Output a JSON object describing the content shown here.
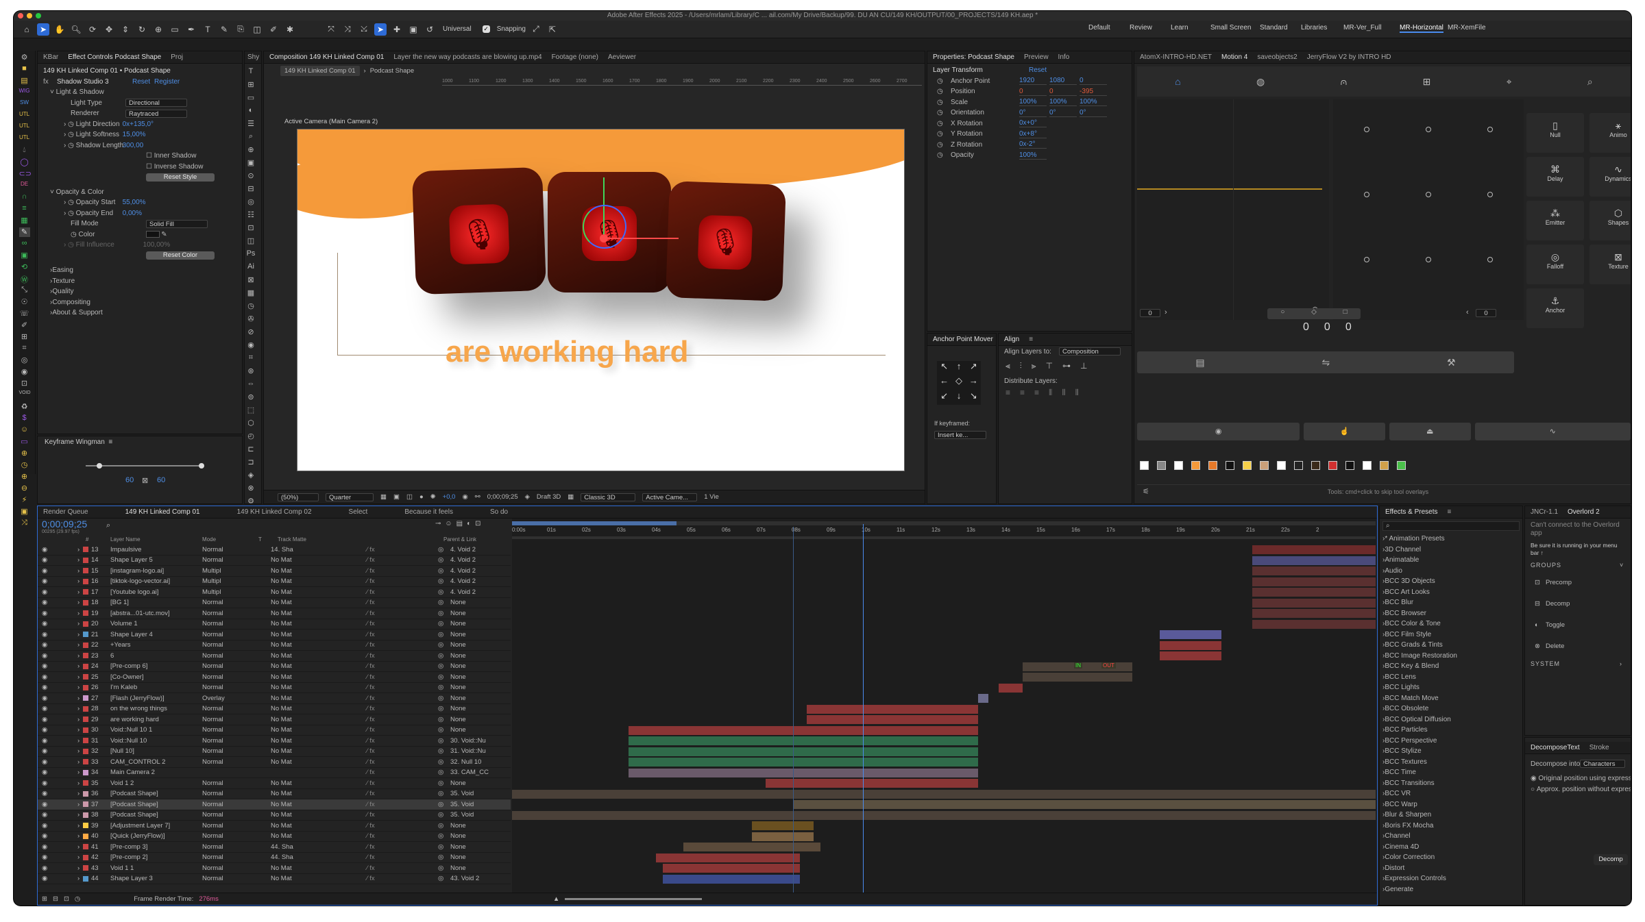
{
  "app": {
    "title": "Adobe After Effects 2025 - /Users/mrlam/Library/C ... ail.com/My Drive/Backup/99. DU AN CU/149 KH/OUTPUT/00_PROJECTS/149 KH.aep *"
  },
  "toolbar": {
    "universal": "Universal",
    "snapping": "Snapping"
  },
  "workspaces": [
    "Default",
    "Review",
    "Learn",
    "Small Screen",
    "Standard",
    "Libraries",
    "MR-Ver_Full",
    "MR-Horizontal",
    "MR-XemFile"
  ],
  "workspace_active": "MR-Horizontal",
  "effect_controls": {
    "tabs": [
      "KBar",
      "Effect Controls Podcast Shape",
      "Proj"
    ],
    "header": "149 KH Linked Comp 01 • Podcast Shape",
    "effect": "Shadow Studio 3",
    "reset": "Reset",
    "register": "Register",
    "section": "Light & Shadow",
    "props": [
      {
        "name": "Light Type",
        "value": "Directional"
      },
      {
        "name": "Renderer",
        "value": "Raytraced"
      },
      {
        "name": "Light Direction",
        "value": "0x+135,0°"
      },
      {
        "name": "Light Softness",
        "value": "15,00%"
      },
      {
        "name": "Shadow Length",
        "value": "300,00"
      }
    ],
    "inner_shadow": "Inner Shadow",
    "inverse_shadow": "Inverse Shadow",
    "reset_style": "Reset Style",
    "opacity_section": "Opacity & Color",
    "opacity_start_label": "Opacity Start",
    "opacity_start": "55,00%",
    "opacity_end_label": "Opacity End",
    "opacity_end": "0,00%",
    "fill_mode_label": "Fill Mode",
    "fill_mode": "Solid Fill",
    "color_label": "Color",
    "fill_influence_label": "Fill Influence",
    "fill_influence": "100,00%",
    "reset_color": "Reset Color",
    "groups": [
      "Easing",
      "Texture",
      "Quality",
      "Compositing",
      "About & Support"
    ]
  },
  "keyframe_wingman": {
    "title": "Keyframe Wingman",
    "left": "60",
    "right": "60"
  },
  "shy_tab": "Shy",
  "composition": {
    "tabs": [
      "Composition 149 KH Linked Comp 01",
      "Layer the new way podcasts are blowing up.mp4",
      "Footage (none)",
      "Aeviewer"
    ],
    "breadcrumb": [
      "149 KH Linked Comp 01",
      "Podcast Shape"
    ],
    "camera_label": "Active Camera (Main Camera 2)",
    "ruler": [
      "1000",
      "1100",
      "1200",
      "1300",
      "1400",
      "1500",
      "1600",
      "1700",
      "1800",
      "1900",
      "2000",
      "2100",
      "2200",
      "2300",
      "2400",
      "2500",
      "2600",
      "2700"
    ],
    "caption": "are working hard",
    "footer": {
      "zoom": "(50%)",
      "res": "Quarter",
      "exposure": "+0,0",
      "time": "0;00;09;25",
      "renderer": "Draft 3D",
      "mode": "Classic 3D",
      "camera": "Active Came...",
      "views": "1 Vie"
    }
  },
  "properties": {
    "tabs": [
      "Properties: Podcast Shape",
      "Preview",
      "Info"
    ],
    "section": "Layer Transform",
    "reset": "Reset",
    "rows": [
      {
        "name": "Anchor Point",
        "v": [
          "1920",
          "1080",
          "0"
        ]
      },
      {
        "name": "Position",
        "v": [
          "0",
          "0",
          "-395"
        ]
      },
      {
        "name": "Scale",
        "v": [
          "100%",
          "100%",
          "100%"
        ]
      },
      {
        "name": "Orientation",
        "v": [
          "0°",
          "0°",
          "0°"
        ]
      },
      {
        "name": "X Rotation",
        "v": [
          "0x+0°"
        ]
      },
      {
        "name": "Y Rotation",
        "v": [
          "0x+8°"
        ]
      },
      {
        "name": "Z Rotation",
        "v": [
          "0x-2°"
        ]
      },
      {
        "name": "Opacity",
        "v": [
          "100%"
        ]
      }
    ]
  },
  "anchor_mover": {
    "title": "Anchor Point Mover",
    "if_keyframed": "If keyframed:",
    "insert": "Insert ke..."
  },
  "align": {
    "title": "Align",
    "align_to_label": "Align Layers to:",
    "align_to": "Composition",
    "distribute": "Distribute Layers:"
  },
  "motion": {
    "tabs": [
      "AtomX-INTRO-HD.NET",
      "Motion 4",
      "saveobjects2",
      "JerryFlow V2 by INTRO HD"
    ],
    "buttons": [
      "Null",
      "Animo",
      "Delay",
      "Dynamics",
      "Emitter",
      "Shapes",
      "Falloff",
      "Texture",
      "Anchor"
    ],
    "fields": [
      "0",
      "0"
    ],
    "counters": [
      "0",
      "0",
      "0"
    ],
    "hint": "Tools: cmd+click to skip tool overlays"
  },
  "timeline": {
    "tabs": [
      "Render Queue",
      "149 KH Linked Comp 01",
      "149 KH Linked Comp 02",
      "Select",
      "Because it feels",
      "So do"
    ],
    "timecode": "0;00;09;25",
    "fps": "00295 (29.97 fps)",
    "columns": [
      "#",
      "Layer Name",
      "Mode",
      "T",
      "Track Matte",
      "Parent & Link"
    ],
    "ruler": [
      "0:00s",
      "01s",
      "02s",
      "03s",
      "04s",
      "05s",
      "06s",
      "07s",
      "08s",
      "09s",
      "10s",
      "11s",
      "12s",
      "13s",
      "14s",
      "15s",
      "16s",
      "17s",
      "18s",
      "19s",
      "20s",
      "21s",
      "22s",
      "2"
    ],
    "layers": [
      {
        "n": "13",
        "name": "Impaulsive",
        "mode": "Normal",
        "matte": "14. Sha",
        "parent": "4. Void 2",
        "color": "#c44"
      },
      {
        "n": "14",
        "name": "Shape Layer 5",
        "mode": "Normal",
        "matte": "No Mat",
        "parent": "4. Void 2",
        "color": "#c44"
      },
      {
        "n": "15",
        "name": "[instagram-logo.ai]",
        "mode": "Multipl",
        "matte": "No Mat",
        "parent": "4. Void 2",
        "color": "#c44"
      },
      {
        "n": "16",
        "name": "[tiktok-logo-vector.ai]",
        "mode": "Multipl",
        "matte": "No Mat",
        "parent": "4. Void 2",
        "color": "#c44"
      },
      {
        "n": "17",
        "name": "[Youtube logo.ai]",
        "mode": "Multipl",
        "matte": "No Mat",
        "parent": "4. Void 2",
        "color": "#c44"
      },
      {
        "n": "18",
        "name": "[BG 1]",
        "mode": "Normal",
        "matte": "No Mat",
        "parent": "None",
        "color": "#c44"
      },
      {
        "n": "19",
        "name": "[abstra...01-utc.mov]",
        "mode": "Normal",
        "matte": "No Mat",
        "parent": "None",
        "color": "#c44"
      },
      {
        "n": "20",
        "name": "Volume 1",
        "mode": "Normal",
        "matte": "No Mat",
        "parent": "None",
        "color": "#c44"
      },
      {
        "n": "21",
        "name": "Shape Layer 4",
        "mode": "Normal",
        "matte": "No Mat",
        "parent": "None",
        "color": "#59c"
      },
      {
        "n": "22",
        "name": "+Years",
        "mode": "Normal",
        "matte": "No Mat",
        "parent": "None",
        "color": "#c44"
      },
      {
        "n": "23",
        "name": "6",
        "mode": "Normal",
        "matte": "No Mat",
        "parent": "None",
        "color": "#c44"
      },
      {
        "n": "24",
        "name": "[Pre-comp 6]",
        "mode": "Normal",
        "matte": "No Mat",
        "parent": "None",
        "color": "#c44"
      },
      {
        "n": "25",
        "name": "[Co-Owner]",
        "mode": "Normal",
        "matte": "No Mat",
        "parent": "None",
        "color": "#c44"
      },
      {
        "n": "26",
        "name": "I'm Kaleb",
        "mode": "Normal",
        "matte": "No Mat",
        "parent": "None",
        "color": "#c44"
      },
      {
        "n": "27",
        "name": "[Flash (JerryFlow)]",
        "mode": "Overlay",
        "matte": "No Mat",
        "parent": "None",
        "color": "#c9c"
      },
      {
        "n": "28",
        "name": "on the wrong things",
        "mode": "Normal",
        "matte": "No Mat",
        "parent": "None",
        "color": "#c44"
      },
      {
        "n": "29",
        "name": "are working hard",
        "mode": "Normal",
        "matte": "No Mat",
        "parent": "None",
        "color": "#c44"
      },
      {
        "n": "30",
        "name": "Void::Null 10 1",
        "mode": "Normal",
        "matte": "No Mat",
        "parent": "None",
        "color": "#c44"
      },
      {
        "n": "31",
        "name": "Void::Null 10",
        "mode": "Normal",
        "matte": "No Mat",
        "parent": "30. Void::Nu",
        "color": "#c44"
      },
      {
        "n": "32",
        "name": "[Null 10]",
        "mode": "Normal",
        "matte": "No Mat",
        "parent": "31. Void::Nu",
        "color": "#c44"
      },
      {
        "n": "33",
        "name": "CAM_CONTROL 2",
        "mode": "Normal",
        "matte": "No Mat",
        "parent": "32. Null 10",
        "color": "#c44"
      },
      {
        "n": "34",
        "name": "Main Camera 2",
        "mode": "",
        "matte": "",
        "parent": "33. CAM_CC",
        "color": "#c9c"
      },
      {
        "n": "35",
        "name": "Void 1 2",
        "mode": "Normal",
        "matte": "No Mat",
        "parent": "None",
        "color": "#c44"
      },
      {
        "n": "36",
        "name": "[Podcast Shape]",
        "mode": "Normal",
        "matte": "No Mat",
        "parent": "35. Void",
        "color": "#c9a"
      },
      {
        "n": "37",
        "name": "[Podcast Shape]",
        "mode": "Normal",
        "matte": "No Mat",
        "parent": "35. Void",
        "color": "#c9a"
      },
      {
        "n": "38",
        "name": "[Podcast Shape]",
        "mode": "Normal",
        "matte": "No Mat",
        "parent": "35. Void",
        "color": "#c9a"
      },
      {
        "n": "39",
        "name": "[Adjustment Layer 7]",
        "mode": "Normal",
        "matte": "No Mat",
        "parent": "None",
        "color": "#fc4"
      },
      {
        "n": "40",
        "name": "[Quick (JerryFlow)]",
        "mode": "Normal",
        "matte": "No Mat",
        "parent": "None",
        "color": "#fa4"
      },
      {
        "n": "41",
        "name": "[Pre-comp 3]",
        "mode": "Normal",
        "matte": "44. Sha",
        "parent": "None",
        "color": "#c44"
      },
      {
        "n": "42",
        "name": "[Pre-comp 2]",
        "mode": "Normal",
        "matte": "44. Sha",
        "parent": "None",
        "color": "#c44"
      },
      {
        "n": "43",
        "name": "Void 1 1",
        "mode": "Normal",
        "matte": "No Mat",
        "parent": "None",
        "color": "#c44"
      },
      {
        "n": "44",
        "name": "Shape Layer 3",
        "mode": "Normal",
        "matte": "No Mat",
        "parent": "43. Void 2",
        "color": "#59c"
      }
    ],
    "frame_render_label": "Frame Render Time:",
    "frame_render": "276ms",
    "in_label": "IN",
    "out_label": "OUT"
  },
  "effects": {
    "title": "Effects & Presets",
    "items": [
      "* Animation Presets",
      "3D Channel",
      "Animatable",
      "Audio",
      "BCC 3D Objects",
      "BCC Art Looks",
      "BCC Blur",
      "BCC Browser",
      "BCC Color & Tone",
      "BCC Film Style",
      "BCC Grads & Tints",
      "BCC Image Restoration",
      "BCC Key & Blend",
      "BCC Lens",
      "BCC Lights",
      "BCC Match Move",
      "BCC Obsolete",
      "BCC Optical Diffusion",
      "BCC Particles",
      "BCC Perspective",
      "BCC Stylize",
      "BCC Textures",
      "BCC Time",
      "BCC Transitions",
      "BCC VR",
      "BCC Warp",
      "Blur & Sharpen",
      "Boris FX Mocha",
      "Channel",
      "Cinema 4D",
      "Color Correction",
      "Distort",
      "Expression Controls",
      "Generate"
    ]
  },
  "overlord": {
    "tabs": [
      "JNCr-1.1",
      "Overlord 2"
    ],
    "msg1": "Can't connect to the Overlord app",
    "msg2": "Be sure it is running in your menu bar ↑",
    "groups": "GROUPS",
    "actions": [
      "Precomp",
      "Decomp",
      "Toggle",
      "Delete"
    ],
    "system": "SYSTEM"
  },
  "decompose": {
    "tabs": [
      "DecomposeText",
      "Stroke"
    ],
    "into_label": "Decompose into:",
    "into": "Characters",
    "opt1": "Original position using expressio",
    "opt2": "Approx. position without expres",
    "button": "Decomp"
  },
  "colors": {
    "accent": "#2e6bd6",
    "orange": "#f59a3a",
    "bar_red": "#8a3535",
    "bar_green": "#2f6b4a"
  }
}
